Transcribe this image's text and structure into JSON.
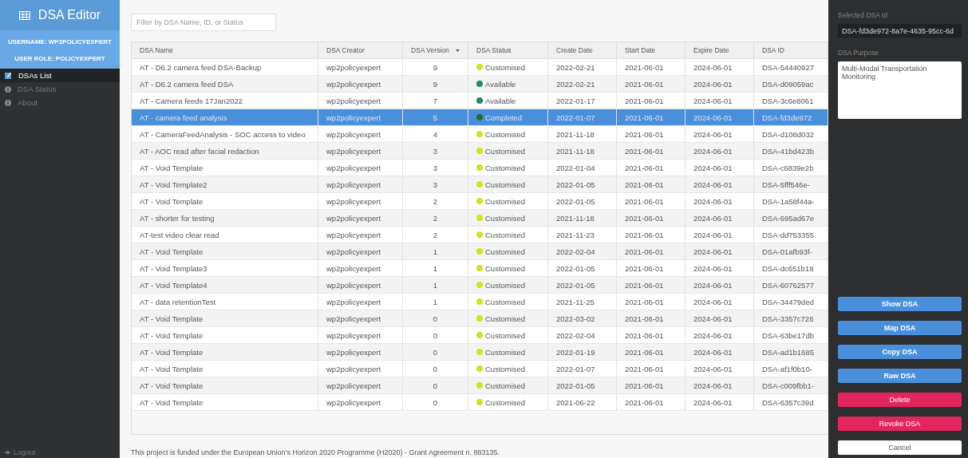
{
  "sidebar": {
    "title": "DSA Editor",
    "username": "USERNAME: WP2POLICYEXPERT",
    "role": "USER ROLE: POLICYEXPERT",
    "items": [
      {
        "label": "DSAs List",
        "selected": true
      },
      {
        "label": "DSA Status",
        "selected": false
      },
      {
        "label": "About",
        "selected": false
      }
    ],
    "logout": "Logout"
  },
  "filter": {
    "placeholder": "Filter by DSA Name, ID, or Status"
  },
  "table": {
    "columns": [
      {
        "label": "DSA Name",
        "sorted": false
      },
      {
        "label": "DSA Creator",
        "sorted": false
      },
      {
        "label": "DSA Version",
        "sorted": true
      },
      {
        "label": "DSA Status",
        "sorted": false
      },
      {
        "label": "Create Date",
        "sorted": false
      },
      {
        "label": "Start Date",
        "sorted": false
      },
      {
        "label": "Expire Date",
        "sorted": false
      },
      {
        "label": "DSA ID",
        "sorted": false
      }
    ],
    "rows": [
      {
        "name": "AT - D6.2 camera feed DSA-Backup",
        "creator": "wp2policyexpert",
        "version": "9",
        "status": "Customised",
        "color": "#d6e01e",
        "create": "2022-02-21",
        "start": "2021-06-01",
        "expire": "2024-06-01",
        "id": "DSA-54440927",
        "selected": false
      },
      {
        "name": "AT - D6.2 camera feed DSA",
        "creator": "wp2policyexpert",
        "version": "9",
        "status": "Available",
        "color": "#1f8a6c",
        "create": "2022-02-21",
        "start": "2021-06-01",
        "expire": "2024-06-01",
        "id": "DSA-d09059ac",
        "selected": false
      },
      {
        "name": "AT - Camera feeds 17Jan2022",
        "creator": "wp2policyexpert",
        "version": "7",
        "status": "Available",
        "color": "#1f8a6c",
        "create": "2022-01-17",
        "start": "2021-06-01",
        "expire": "2024-06-01",
        "id": "DSA-3c6e8061",
        "selected": false
      },
      {
        "name": "AT - camera feed analysis",
        "creator": "wp2policyexpert",
        "version": "5",
        "status": "Completed",
        "color": "#2e6b1e",
        "create": "2022-01-07",
        "start": "2021-06-01",
        "expire": "2024-06-01",
        "id": "DSA-fd3de972",
        "selected": true
      },
      {
        "name": "AT - CameraFeedAnalysis - SOC access to video",
        "creator": "wp2policyexpert",
        "version": "4",
        "status": "Customised",
        "color": "#d6e01e",
        "create": "2021-11-18",
        "start": "2021-06-01",
        "expire": "2024-06-01",
        "id": "DSA-d108d032",
        "selected": false
      },
      {
        "name": "AT - AOC read after facial redaction",
        "creator": "wp2policyexpert",
        "version": "3",
        "status": "Customised",
        "color": "#d6e01e",
        "create": "2021-11-18",
        "start": "2021-06-01",
        "expire": "2024-06-01",
        "id": "DSA-41bd423b",
        "selected": false
      },
      {
        "name": "AT - Void Template",
        "creator": "wp2policyexpert",
        "version": "3",
        "status": "Customised",
        "color": "#d6e01e",
        "create": "2022-01-04",
        "start": "2021-06-01",
        "expire": "2024-06-01",
        "id": "DSA-c6839e2b",
        "selected": false
      },
      {
        "name": "AT - Void Template2",
        "creator": "wp2policyexpert",
        "version": "3",
        "status": "Customised",
        "color": "#d6e01e",
        "create": "2022-01-05",
        "start": "2021-06-01",
        "expire": "2024-06-01",
        "id": "DSA-5fff546e-",
        "selected": false
      },
      {
        "name": "AT - Void Template",
        "creator": "wp2policyexpert",
        "version": "2",
        "status": "Customised",
        "color": "#d6e01e",
        "create": "2022-01-05",
        "start": "2021-06-01",
        "expire": "2024-06-01",
        "id": "DSA-1a58f44a-",
        "selected": false
      },
      {
        "name": "AT - shorter for testing",
        "creator": "wp2policyexpert",
        "version": "2",
        "status": "Customised",
        "color": "#d6e01e",
        "create": "2021-11-18",
        "start": "2021-06-01",
        "expire": "2024-06-01",
        "id": "DSA-695ad67e",
        "selected": false
      },
      {
        "name": "AT-test video clear read",
        "creator": "wp2policyexpert",
        "version": "2",
        "status": "Customised",
        "color": "#d6e01e",
        "create": "2021-11-23",
        "start": "2021-06-01",
        "expire": "2024-06-01",
        "id": "DSA-dd753355",
        "selected": false
      },
      {
        "name": "AT - Void Template",
        "creator": "wp2policyexpert",
        "version": "1",
        "status": "Customised",
        "color": "#d6e01e",
        "create": "2022-02-04",
        "start": "2021-06-01",
        "expire": "2024-06-01",
        "id": "DSA-01afb93f-",
        "selected": false
      },
      {
        "name": "AT - Void Template3",
        "creator": "wp2policyexpert",
        "version": "1",
        "status": "Customised",
        "color": "#d6e01e",
        "create": "2022-01-05",
        "start": "2021-06-01",
        "expire": "2024-06-01",
        "id": "DSA-dc651b18",
        "selected": false
      },
      {
        "name": "AT - Void Template4",
        "creator": "wp2policyexpert",
        "version": "1",
        "status": "Customised",
        "color": "#d6e01e",
        "create": "2022-01-05",
        "start": "2021-06-01",
        "expire": "2024-06-01",
        "id": "DSA-60762577",
        "selected": false
      },
      {
        "name": "AT - data retentionTest",
        "creator": "wp2policyexpert",
        "version": "1",
        "status": "Customised",
        "color": "#d6e01e",
        "create": "2021-11-25",
        "start": "2021-06-01",
        "expire": "2024-06-01",
        "id": "DSA-34479ded",
        "selected": false
      },
      {
        "name": "AT - Void Template",
        "creator": "wp2policyexpert",
        "version": "0",
        "status": "Customised",
        "color": "#d6e01e",
        "create": "2022-03-02",
        "start": "2021-06-01",
        "expire": "2024-06-01",
        "id": "DSA-3357c726",
        "selected": false
      },
      {
        "name": "AT - Void Template",
        "creator": "wp2policyexpert",
        "version": "0",
        "status": "Customised",
        "color": "#d6e01e",
        "create": "2022-02-04",
        "start": "2021-06-01",
        "expire": "2024-06-01",
        "id": "DSA-63be17db",
        "selected": false
      },
      {
        "name": "AT - Void Template",
        "creator": "wp2policyexpert",
        "version": "0",
        "status": "Customised",
        "color": "#d6e01e",
        "create": "2022-01-19",
        "start": "2021-06-01",
        "expire": "2024-06-01",
        "id": "DSA-ad1b1685",
        "selected": false
      },
      {
        "name": "AT - Void Template",
        "creator": "wp2policyexpert",
        "version": "0",
        "status": "Customised",
        "color": "#d6e01e",
        "create": "2022-01-07",
        "start": "2021-06-01",
        "expire": "2024-06-01",
        "id": "DSA-af1f0b10-",
        "selected": false
      },
      {
        "name": "AT - Void Template",
        "creator": "wp2policyexpert",
        "version": "0",
        "status": "Customised",
        "color": "#d6e01e",
        "create": "2022-01-05",
        "start": "2021-06-01",
        "expire": "2024-06-01",
        "id": "DSA-c009fbb1-",
        "selected": false
      },
      {
        "name": "AT - Void Template",
        "creator": "wp2policyexpert",
        "version": "0",
        "status": "Customised",
        "color": "#d6e01e",
        "create": "2021-06-22",
        "start": "2021-06-01",
        "expire": "2024-06-01",
        "id": "DSA-6357c39d",
        "selected": false
      }
    ]
  },
  "footer": "This project is funded under the European Union’s Horizon 2020 Programme (H2020) - Grant Agreement n. 883135.",
  "panel": {
    "id_label": "Selected DSA Id",
    "id_value": "DSA-fd3de972-8a7e-4635-95cc-6d",
    "purpose_label": "DSA Purpose",
    "purpose_value": "Multi-Modal Transportation Monitoring",
    "buttons": [
      {
        "label": "Show DSA",
        "kind": "primary"
      },
      {
        "label": "Map DSA",
        "kind": "primary"
      },
      {
        "label": "Copy DSA",
        "kind": "primary"
      },
      {
        "label": "Raw DSA",
        "kind": "primary"
      },
      {
        "label": "Delete",
        "kind": "danger"
      },
      {
        "label": "Revoke DSA",
        "kind": "danger"
      },
      {
        "label": "Cancel",
        "kind": "plain"
      }
    ]
  }
}
